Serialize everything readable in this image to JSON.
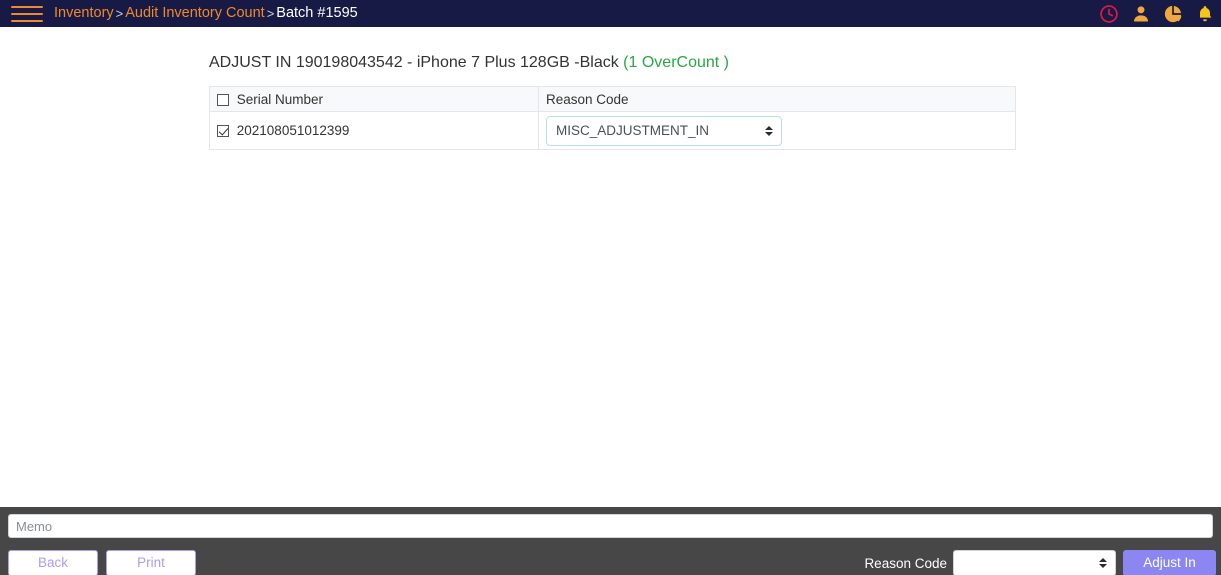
{
  "navbar": {
    "menu_icon": "hamburger-menu-icon",
    "breadcrumb": {
      "item1": "Inventory",
      "sep1": ">",
      "item2": "Audit Inventory Count",
      "sep2": ">",
      "current": "Batch #1595"
    },
    "icons": [
      {
        "name": "clock-icon",
        "color": "#e8174a"
      },
      {
        "name": "user-icon",
        "color": "#f0a73e"
      },
      {
        "name": "pie-chart-icon",
        "color": "#f0a73e"
      },
      {
        "name": "bell-icon",
        "color": "#f5c518"
      }
    ]
  },
  "main": {
    "title_text": "ADJUST IN 190198043542 - iPhone 7 Plus 128GB -Black",
    "title_badge": "(1 OverCount )",
    "badge_color": "#28a745",
    "table": {
      "headers": {
        "serial": "Serial Number",
        "reason": "Reason Code"
      },
      "header_checkbox_checked": false,
      "rows": [
        {
          "checked": true,
          "serial": "202108051012399",
          "reason_code": "MISC_ADJUSTMENT_IN"
        }
      ]
    }
  },
  "footer": {
    "memo_placeholder": "Memo",
    "memo_value": "",
    "back_label": "Back",
    "print_label": "Print",
    "reason_label": "Reason Code",
    "reason_value": "",
    "submit_label": "Adjust In",
    "submit_color": "#8c86f2",
    "outline_color": "#a99ef0",
    "bar_color": "#474747"
  }
}
